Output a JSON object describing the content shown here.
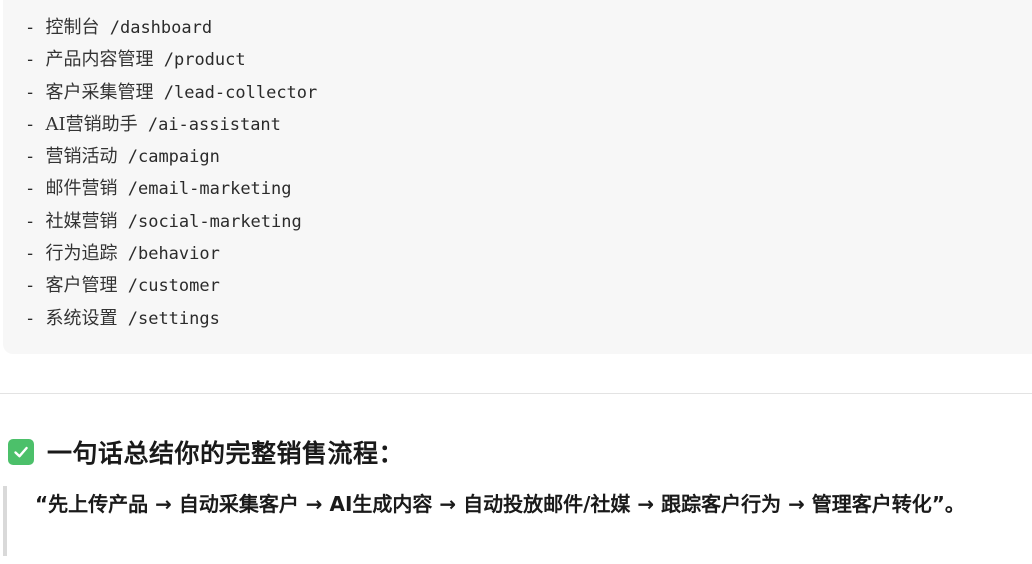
{
  "routes": [
    {
      "prefix": "- ",
      "name": "控制台",
      "path": "/dashboard"
    },
    {
      "prefix": "- ",
      "name": "产品内容管理",
      "path": "/product"
    },
    {
      "prefix": "- ",
      "name": "客户采集管理",
      "path": "/lead-collector"
    },
    {
      "prefix": "- ",
      "name": "AI营销助手",
      "path": "/ai-assistant"
    },
    {
      "prefix": "- ",
      "name": "营销活动",
      "path": "/campaign"
    },
    {
      "prefix": "- ",
      "name": "邮件营销",
      "path": "/email-marketing"
    },
    {
      "prefix": "- ",
      "name": "社媒营销",
      "path": "/social-marketing"
    },
    {
      "prefix": "- ",
      "name": "行为追踪",
      "path": "/behavior"
    },
    {
      "prefix": "- ",
      "name": "客户管理",
      "path": "/customer"
    },
    {
      "prefix": "- ",
      "name": "系统设置",
      "path": "/settings"
    }
  ],
  "summary": {
    "icon": "check-mark-icon",
    "icon_color": "#4cc06a",
    "heading": "一句话总结你的完整销售流程：",
    "quote": "“先上传产品 → 自动采集客户 → AI生成内容 → 自动投放邮件/社媒 → 跟踪客户行为 → 管理客户转化”。"
  }
}
